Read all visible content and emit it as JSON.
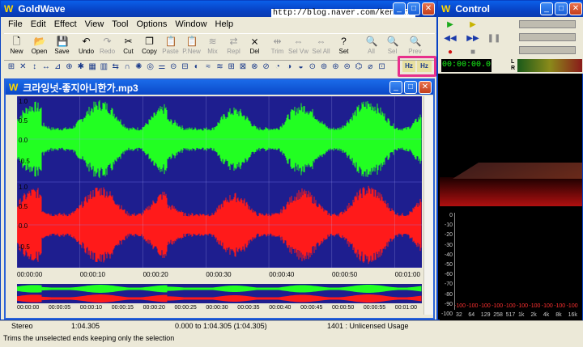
{
  "main_window": {
    "title": "GoldWave",
    "url_overlay": "http://blog.naver.com/kentsh2",
    "menu": [
      "File",
      "Edit",
      "Effect",
      "View",
      "Tool",
      "Options",
      "Window",
      "Help"
    ]
  },
  "toolbar": {
    "buttons": [
      {
        "label": "New",
        "icon": "new-file-icon",
        "enabled": true
      },
      {
        "label": "Open",
        "icon": "open-folder-icon",
        "enabled": true
      },
      {
        "label": "Save",
        "icon": "save-disk-icon",
        "enabled": true
      },
      {
        "label": "Undo",
        "icon": "undo-icon",
        "enabled": true
      },
      {
        "label": "Redo",
        "icon": "redo-icon",
        "enabled": false
      },
      {
        "label": "Cut",
        "icon": "scissors-icon",
        "enabled": true
      },
      {
        "label": "Copy",
        "icon": "copy-icon",
        "enabled": true
      },
      {
        "label": "Paste",
        "icon": "paste-icon",
        "enabled": false
      },
      {
        "label": "P.New",
        "icon": "paste-new-icon",
        "enabled": false
      },
      {
        "label": "Mix",
        "icon": "mix-icon",
        "enabled": false
      },
      {
        "label": "Repl",
        "icon": "replace-icon",
        "enabled": false
      },
      {
        "label": "Del",
        "icon": "delete-icon",
        "enabled": true
      },
      {
        "label": "Trim",
        "icon": "trim-icon",
        "enabled": false
      },
      {
        "label": "Sel Vw",
        "icon": "select-view-icon",
        "enabled": false
      },
      {
        "label": "Sel All",
        "icon": "select-all-icon",
        "enabled": false
      },
      {
        "label": "Set",
        "icon": "set-icon",
        "enabled": true
      },
      {
        "label": "All",
        "icon": "zoom-all-icon",
        "enabled": false
      },
      {
        "label": "Sel",
        "icon": "zoom-selection-icon",
        "enabled": false
      },
      {
        "label": "Prev",
        "icon": "zoom-previous-icon",
        "enabled": false
      }
    ],
    "highlight_labels": [
      "Hz",
      "Hz"
    ],
    "highlight_color": "#e8308c"
  },
  "document": {
    "title": "크라잉넛-좋지아니한가.mp3",
    "channel_colors": {
      "left": "#22ff22",
      "right": "#ff1a1a",
      "background": "#1e1e8f"
    },
    "y_ticks_top": [
      "1.0",
      "0.5",
      "0.0",
      "-0.5"
    ],
    "y_ticks_bottom": [
      "1.0",
      "0.5",
      "0.0",
      "-0.5"
    ],
    "time_ticks": [
      "00:00:00",
      "00:00:10",
      "00:00:20",
      "00:00:30",
      "00:00:40",
      "00:00:50",
      "00:01:00"
    ],
    "overview_ticks": [
      "00:00:00",
      "00:00:05",
      "00:00:10",
      "00:00:15",
      "00:00:20",
      "00:00:25",
      "00:00:30",
      "00:00:35",
      "00:00:40",
      "00:00:45",
      "00:00:50",
      "00:00:55",
      "00:01:00"
    ]
  },
  "status": {
    "channels": "Stereo",
    "length": "1:04.305",
    "selection": "0.000 to 1:04.305 (1:04.305)",
    "license": "1401 : Unlicensed Usage",
    "hint": "Trims the unselected ends keeping only the selection"
  },
  "control": {
    "title": "Control",
    "time_display": "00:00:00.0",
    "meter_labels": [
      "L",
      "R"
    ],
    "db_ticks": [
      "0",
      "-10",
      "-20",
      "-30",
      "-40",
      "-50",
      "-60",
      "-70",
      "-80",
      "-90",
      "-100"
    ],
    "freq_ticks": [
      "32",
      "64",
      "129",
      "258",
      "517",
      "1k",
      "2k",
      "4k",
      "8k",
      "16k"
    ],
    "peak_labels": [
      "-100",
      "-100",
      "-100",
      "-100",
      "-100",
      "-100",
      "-100",
      "-100",
      "-100",
      "-100"
    ]
  }
}
